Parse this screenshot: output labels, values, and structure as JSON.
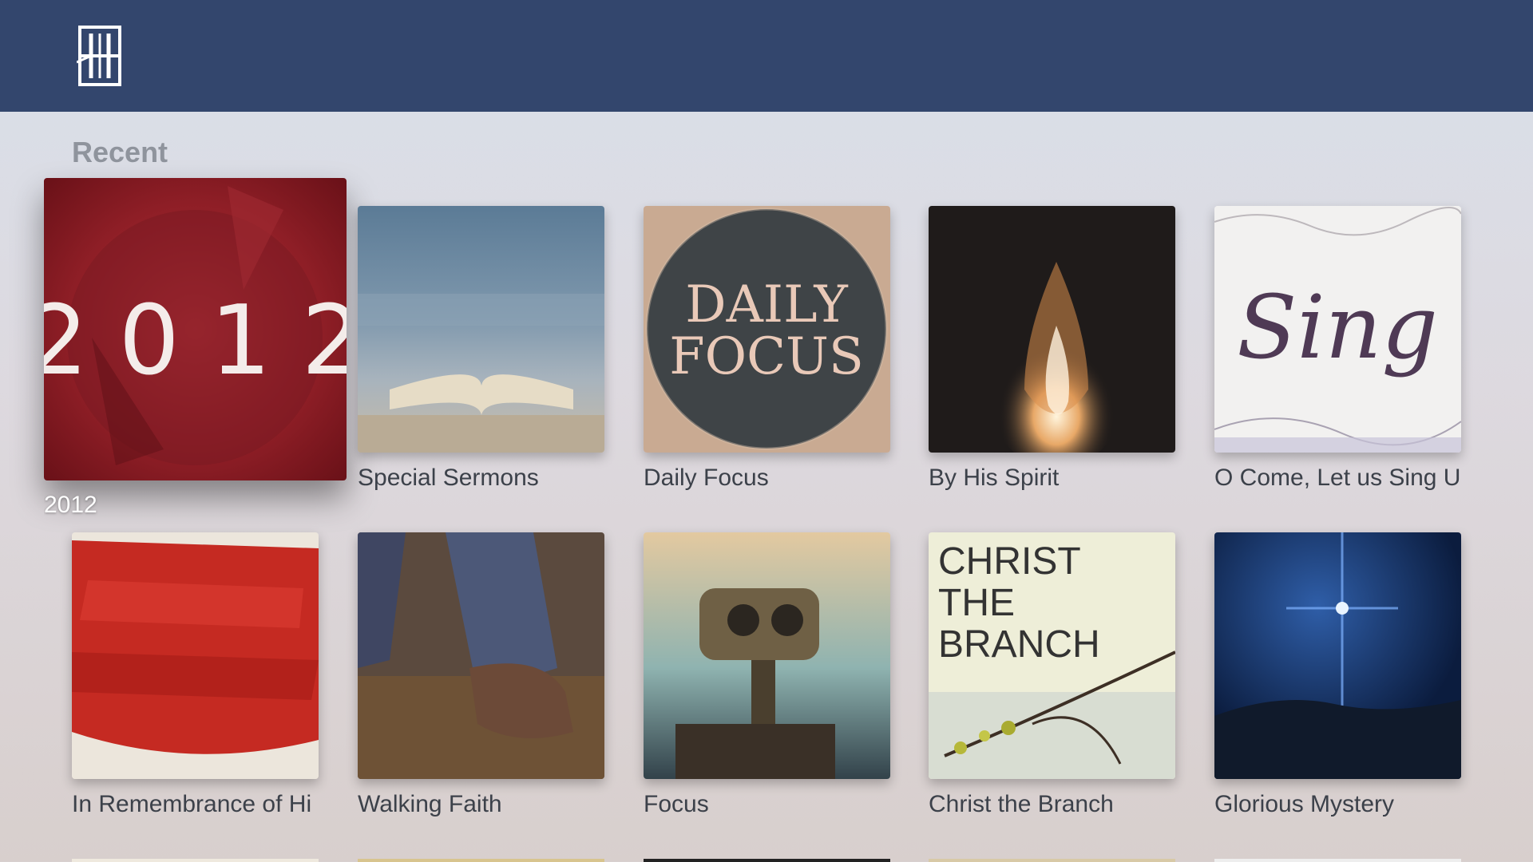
{
  "app": {
    "logo_icon": "church-logo-icon"
  },
  "section": {
    "title": "Recent"
  },
  "tiles": [
    {
      "label": "2012",
      "art_text": "2 0 1 2",
      "focused": true
    },
    {
      "label": "Special Sermons"
    },
    {
      "label": "Daily Focus",
      "art_text_line1": "DAILY",
      "art_text_line2": "FOCUS"
    },
    {
      "label": "By His Spirit"
    },
    {
      "label": "O Come, Let us Sing U",
      "art_text": "Sing"
    },
    {
      "label": "In Remembrance of Hi"
    },
    {
      "label": "Walking Faith"
    },
    {
      "label": "Focus"
    },
    {
      "label": "Christ the Branch",
      "art_text_line1": "CHRIST",
      "art_text_line2": "THE",
      "art_text_line3": "BRANCH"
    },
    {
      "label": "Glorious Mystery"
    }
  ],
  "colors": {
    "topbar": "#33466d",
    "section_title": "#8f949d",
    "label": "#3c414a",
    "focused_label": "#ffffff"
  }
}
